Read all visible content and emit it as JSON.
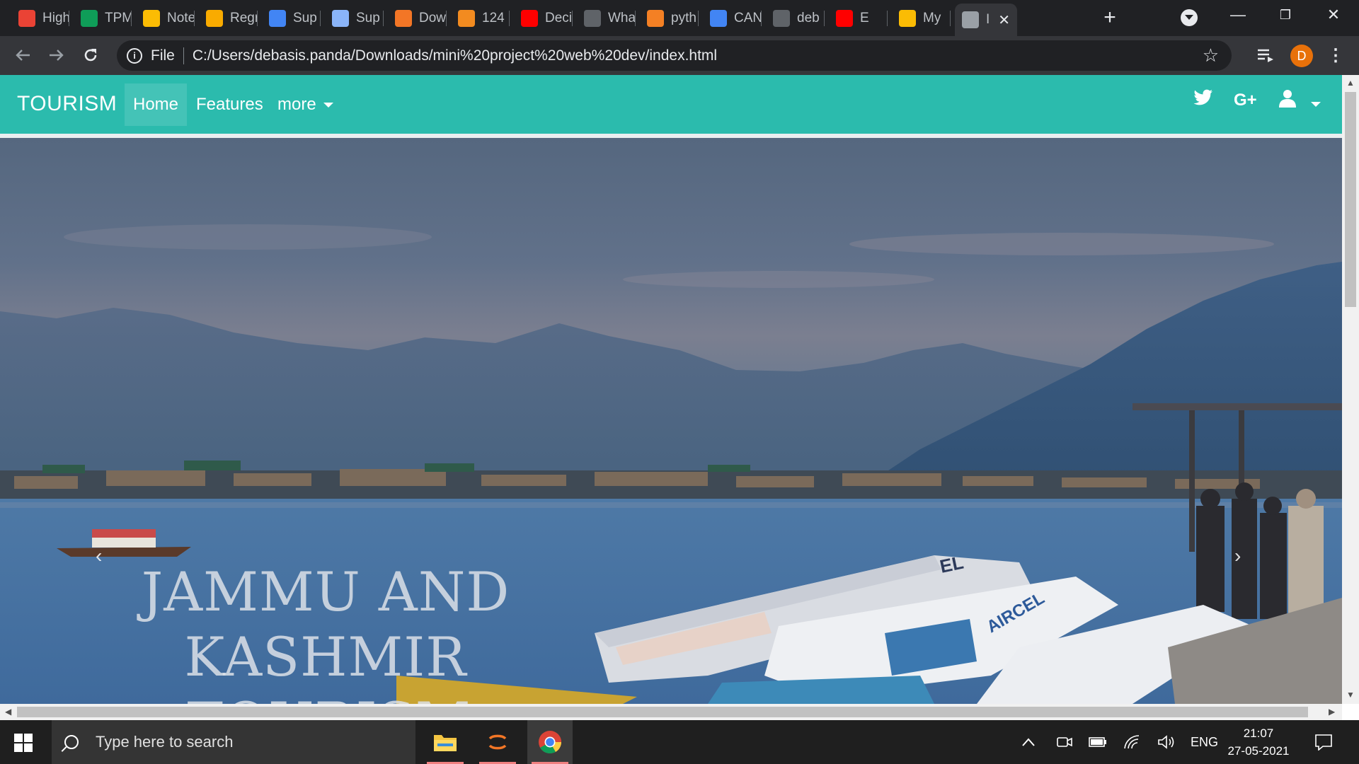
{
  "browser": {
    "tabs": [
      {
        "label": "High",
        "icon": "gmail-icon",
        "color": "#ea4335"
      },
      {
        "label": "TPM",
        "icon": "sheets-icon",
        "color": "#0f9d58"
      },
      {
        "label": "Note",
        "icon": "drive-icon",
        "color": "#fbbc04"
      },
      {
        "label": "Regr",
        "icon": "colab-icon",
        "color": "#f9ab00"
      },
      {
        "label": "Sup",
        "icon": "docs-icon",
        "color": "#4285f4"
      },
      {
        "label": "Sup",
        "icon": "doc-image-icon",
        "color": "#8ab4f8"
      },
      {
        "label": "Dow",
        "icon": "jupyter-icon",
        "color": "#f37626"
      },
      {
        "label": "124",
        "icon": "book-icon",
        "color": "#f28b20"
      },
      {
        "label": "Deci",
        "icon": "youtube-icon",
        "color": "#ff0000"
      },
      {
        "label": "Wha",
        "icon": "medium-icon",
        "color": "#ffffff"
      },
      {
        "label": "pyth",
        "icon": "stackoverflow-icon",
        "color": "#f48024"
      },
      {
        "label": "CAN",
        "icon": "google-icon",
        "color": "#4285f4"
      },
      {
        "label": "deb",
        "icon": "github-icon",
        "color": "#ffffff"
      },
      {
        "label": "E",
        "icon": "youtube-icon",
        "color": "#ff0000"
      },
      {
        "label": "My",
        "icon": "drive-icon",
        "color": "#fbbc04"
      },
      {
        "label": "I",
        "icon": "globe-icon",
        "color": "#9aa0a6",
        "active": true
      }
    ],
    "scheme": "File",
    "url": "C:/Users/debasis.panda/Downloads/mini%20project%20web%20dev/index.html",
    "profile_initial": "D"
  },
  "site": {
    "brand": "TOURISM",
    "nav": [
      {
        "label": "Home",
        "active": true
      },
      {
        "label": "Features",
        "active": false
      },
      {
        "label": "more",
        "active": false
      }
    ],
    "hero_title_line1": "JAMMU AND KASHMIR",
    "hero_title_line2": "TOURISM",
    "colors": {
      "navbar": "#2bbbad"
    }
  },
  "taskbar": {
    "search_placeholder": "Type here to search",
    "language": "ENG",
    "time": "21:07",
    "date": "27-05-2021"
  }
}
